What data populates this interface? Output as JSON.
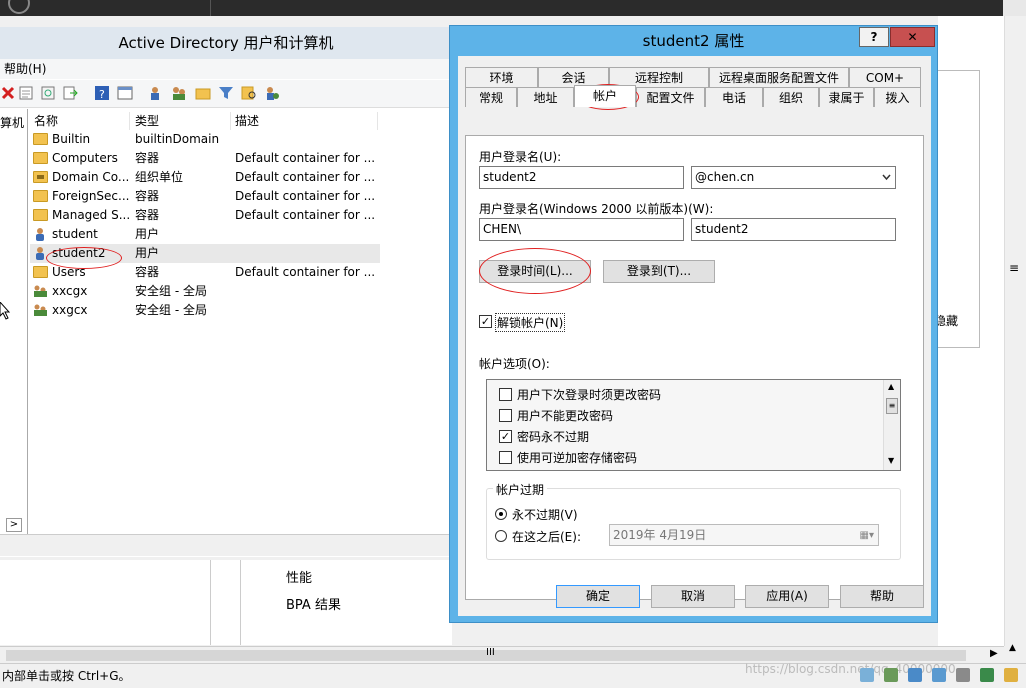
{
  "aduc": {
    "title": "Active Directory 用户和计算机",
    "menu_help": "帮助(H)",
    "tree_label": "算机",
    "columns": {
      "name": "名称",
      "type": "类型",
      "desc": "描述"
    },
    "rows": [
      {
        "name": "Builtin",
        "type": "builtinDomain",
        "desc": "",
        "icon": "folder-icon"
      },
      {
        "name": "Computers",
        "type": "容器",
        "desc": "Default container for ...",
        "icon": "folder-icon"
      },
      {
        "name": "Domain Co...",
        "type": "组织单位",
        "desc": "Default container for ...",
        "icon": "ou-folder-icon"
      },
      {
        "name": "ForeignSec...",
        "type": "容器",
        "desc": "Default container for ...",
        "icon": "folder-icon"
      },
      {
        "name": "Managed S...",
        "type": "容器",
        "desc": "Default container for ...",
        "icon": "folder-icon"
      },
      {
        "name": "student",
        "type": "用户",
        "desc": "",
        "icon": "user-icon"
      },
      {
        "name": "student2",
        "type": "用户",
        "desc": "",
        "icon": "user-icon"
      },
      {
        "name": "Users",
        "type": "容器",
        "desc": "Default container for ...",
        "icon": "folder-icon"
      },
      {
        "name": "xxcgx",
        "type": "安全组 - 全局",
        "desc": "",
        "icon": "group-icon"
      },
      {
        "name": "xxgcx",
        "type": "安全组 - 全局",
        "desc": "",
        "icon": "group-icon"
      }
    ]
  },
  "lower": {
    "perf": "性能",
    "bpa": "BPA 结果"
  },
  "right": {
    "hidden": "隐藏"
  },
  "status": {
    "text": "内部单击或按 Ctrl+G。",
    "watermark": "https://blog.csdn.net/qq_40000000"
  },
  "dialog": {
    "title": "student2 属性",
    "help_btn": "?",
    "close_btn": "✕",
    "tabs_row1": [
      "环境",
      "会话",
      "远程控制",
      "远程桌面服务配置文件",
      "COM+"
    ],
    "tabs_row2": [
      "常规",
      "地址",
      "帐户",
      "配置文件",
      "电话",
      "组织",
      "隶属于",
      "拨入"
    ],
    "logon_name_label": "用户登录名(U):",
    "logon_name_value": "student2",
    "domain_value": "@chen.cn",
    "pre2000_label": "用户登录名(Windows 2000 以前版本)(W):",
    "pre2000_domain": "CHEN\\",
    "pre2000_name": "student2",
    "logon_hours_btn": "登录时间(L)...",
    "logon_to_btn": "登录到(T)...",
    "unlock_label": "解锁帐户(N)",
    "options_label": "帐户选项(O):",
    "options": [
      {
        "label": "用户下次登录时须更改密码",
        "checked": false
      },
      {
        "label": "用户不能更改密码",
        "checked": false
      },
      {
        "label": "密码永不过期",
        "checked": true
      },
      {
        "label": "使用可逆加密存储密码",
        "checked": false
      }
    ],
    "expire_label": "帐户过期",
    "never_label": "永不过期(V)",
    "after_label": "在这之后(E):",
    "date_value": "2019年  4月19日",
    "ok": "确定",
    "cancel": "取消",
    "apply": "应用(A)",
    "help": "帮助"
  }
}
